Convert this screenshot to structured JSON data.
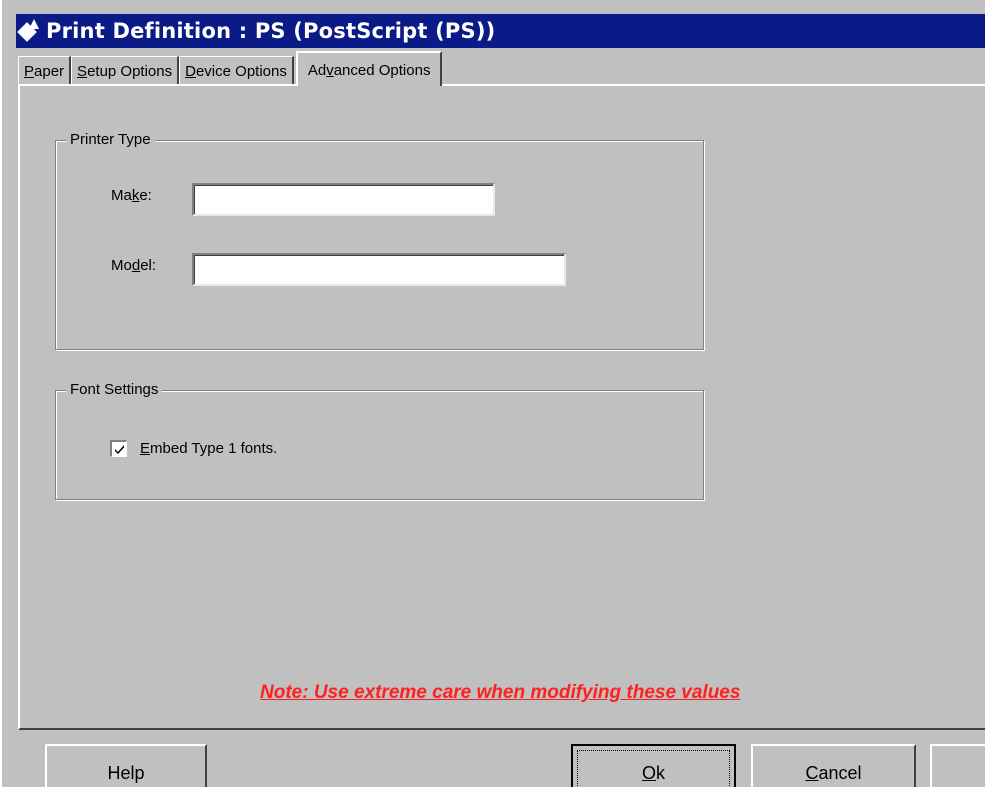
{
  "window": {
    "title": "Print Definition : PS (PostScript (PS))",
    "title_bar_color": "#0a1a86",
    "icon": "app-icon"
  },
  "tabs": [
    {
      "pre": "",
      "mnemonic": "P",
      "post": "aper",
      "active": false
    },
    {
      "pre": "",
      "mnemonic": "S",
      "post": "etup Options",
      "active": false
    },
    {
      "pre": "",
      "mnemonic": "D",
      "post": "evice Options",
      "active": false
    },
    {
      "pre": "Ad",
      "mnemonic": "v",
      "post": "anced Options",
      "active": true
    }
  ],
  "printer_type": {
    "legend": "Printer Type",
    "make": {
      "label_pre": "Ma",
      "label_mnemonic": "k",
      "label_post": "e:",
      "value": ""
    },
    "model": {
      "label_pre": "Mo",
      "label_mnemonic": "d",
      "label_post": "el:",
      "value": ""
    }
  },
  "font_settings": {
    "legend": "Font Settings",
    "embed": {
      "checked": true,
      "label_mnemonic": "E",
      "label_post": "mbed Type 1 fonts."
    }
  },
  "note": {
    "text": "Note: Use extreme care when modifying these values",
    "color": "#ff2020"
  },
  "buttons": {
    "help": "Help",
    "ok": {
      "mnemonic": "O",
      "post": "k"
    },
    "cancel": {
      "mnemonic": "C",
      "post": "ancel"
    }
  }
}
